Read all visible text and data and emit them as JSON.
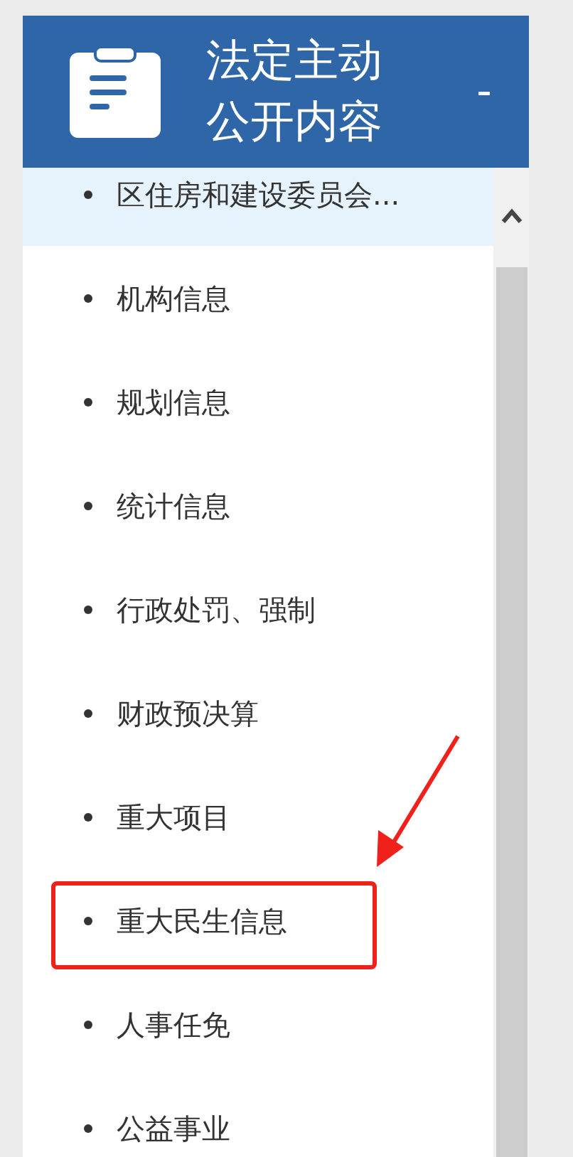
{
  "header": {
    "title_lines": [
      "法定主动",
      "公开内容"
    ],
    "toggle": "-"
  },
  "items": [
    {
      "label": "区住房和建设委员会...",
      "selected": true
    },
    {
      "label": "机构信息",
      "selected": false
    },
    {
      "label": "规划信息",
      "selected": false
    },
    {
      "label": "统计信息",
      "selected": false
    },
    {
      "label": "行政处罚、强制",
      "selected": false
    },
    {
      "label": "财政预决算",
      "selected": false
    },
    {
      "label": "重大项目",
      "selected": false
    },
    {
      "label": "重大民生信息",
      "selected": false
    },
    {
      "label": "人事任免",
      "selected": false
    },
    {
      "label": "公益事业",
      "selected": false
    }
  ]
}
